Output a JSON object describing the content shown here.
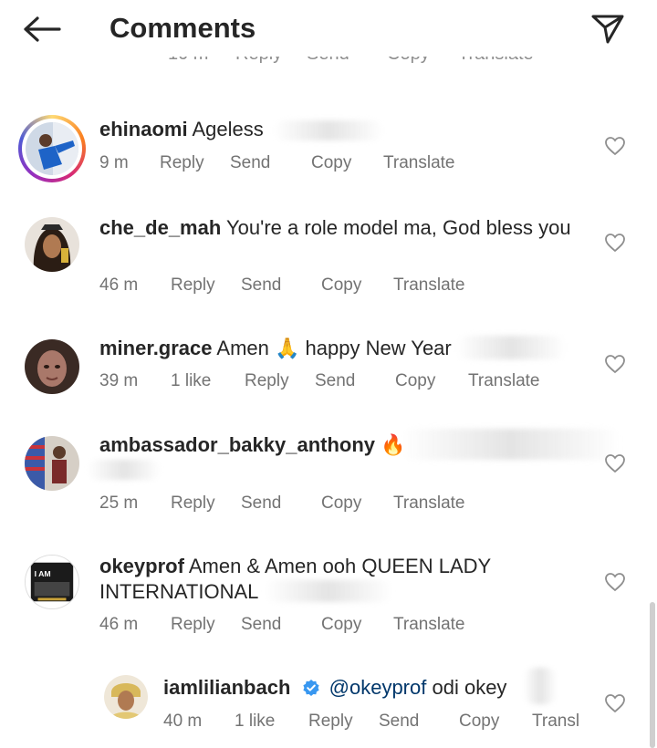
{
  "header": {
    "title": "Comments",
    "back_icon": "arrow-left-icon",
    "share_icon": "paper-plane-icon"
  },
  "partial_row": {
    "time": "10 m",
    "reply": "Reply",
    "send": "Send",
    "copy": "Copy",
    "translate": "Translate"
  },
  "comments": [
    {
      "username": "ehinaomi",
      "text": "Ageless",
      "time": "9 m",
      "likes": "",
      "reply": "Reply",
      "send": "Send",
      "copy": "Copy",
      "translate": "Translate"
    },
    {
      "username": "che_de_mah",
      "text": "You're a role model ma, God bless you",
      "time": "46 m",
      "likes": "",
      "reply": "Reply",
      "send": "Send",
      "copy": "Copy",
      "translate": "Translate"
    },
    {
      "username": "miner.grace",
      "text": "Amen 🙏 happy New Year",
      "time": "39 m",
      "likes": "1 like",
      "reply": "Reply",
      "send": "Send",
      "copy": "Copy",
      "translate": "Translate"
    },
    {
      "username": "ambassador_bakky_anthony",
      "text": "🔥",
      "time": "25 m",
      "likes": "",
      "reply": "Reply",
      "send": "Send",
      "copy": "Copy",
      "translate": "Translate"
    },
    {
      "username": "okeyprof",
      "text": "Amen & Amen ooh QUEEN LADY INTERNATIONAL",
      "time": "46 m",
      "likes": "",
      "reply": "Reply",
      "send": "Send",
      "copy": "Copy",
      "translate": "Translate"
    },
    {
      "username": "iamlilianbach",
      "mention": "@okeyprof",
      "text": "odi okey",
      "time": "40 m",
      "likes": "1 like",
      "reply": "Reply",
      "send": "Send",
      "copy": "Copy",
      "translate": "Transl"
    }
  ],
  "colors": {
    "text": "#262626",
    "meta": "#737373",
    "mention": "#00376b",
    "verified": "#3897f0"
  }
}
